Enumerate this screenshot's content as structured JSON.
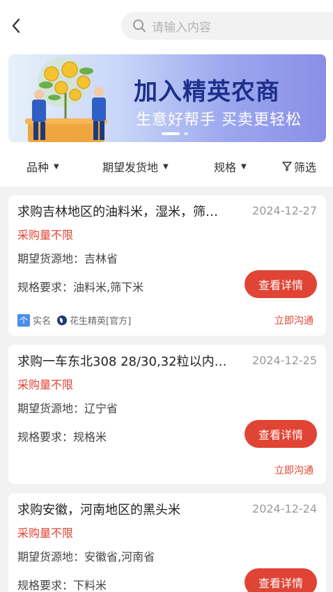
{
  "header": {
    "search_placeholder": "请输入内容"
  },
  "banner": {
    "title": "加入精英农商",
    "subtitle": "生意好帮手  买卖更轻松"
  },
  "filters": {
    "variety": "品种",
    "origin": "期望发货地",
    "spec": "规格",
    "screen": "筛选"
  },
  "cards": [
    {
      "title": "求购吉林地区的油料米，湿米，筛…",
      "date": "2024-12-27",
      "quantity": "采购量不限",
      "origin": "期望货源地：吉林省",
      "spec": "规格要求：油料米,筛下米",
      "button": "查看详情",
      "realname": "实名",
      "realname_badge": "个",
      "publisher": "花生精英[官方]",
      "chat": "立即沟通"
    },
    {
      "title": "求购一车东北308 28/30,32粒以内…",
      "date": "2024-12-25",
      "quantity": "采购量不限",
      "origin": "期望货源地：辽宁省",
      "spec": "规格要求：规格米",
      "button": "查看详情",
      "chat": "立即沟通"
    },
    {
      "title": "求购安徽，河南地区的黑头米",
      "date": "2024-12-24",
      "quantity": "采购量不限",
      "origin": "期望货源地：安徽省,河南省",
      "spec": "规格要求：下料米",
      "button": "查看详情"
    }
  ],
  "colors": {
    "accent": "#e04434",
    "banner_title": "#1e2f8a",
    "badge": "#4a8ff0"
  }
}
